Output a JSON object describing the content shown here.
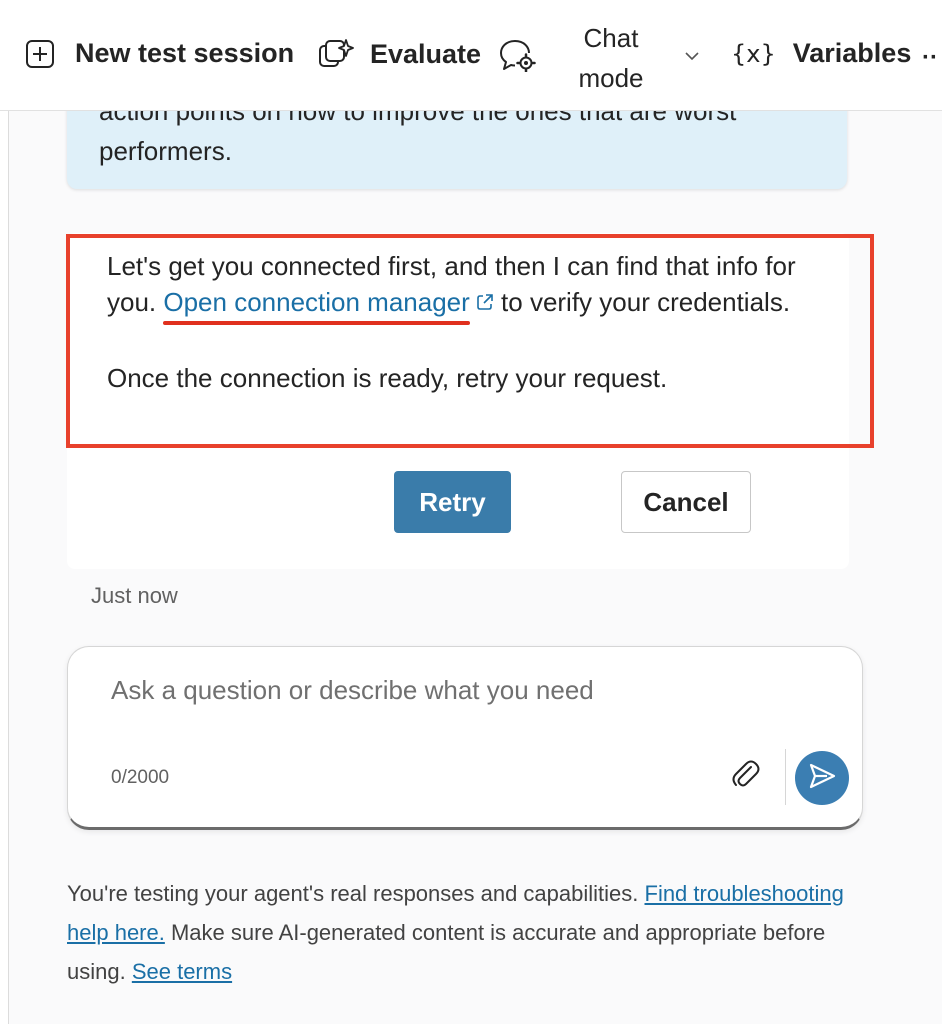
{
  "toolbar": {
    "new_session_label": "New test session",
    "evaluate_label": "Evaluate",
    "chat_mode_label": "Chat mode",
    "variables_label": "Variables",
    "variables_icon_text": "{x}",
    "more_label": "··"
  },
  "chat": {
    "user_message_line1": "action points on how to improve the ones that are worst",
    "user_message_line2": "performers.",
    "bot_text_before_link": "Let's get you connected first, and then I can find that info for you. ",
    "bot_link_text": "Open connection manager",
    "bot_text_after_link": " to verify your credentials.",
    "bot_second_paragraph": "Once the connection is ready, retry your request.",
    "retry_label": "Retry",
    "cancel_label": "Cancel",
    "timestamp": "Just now"
  },
  "input": {
    "placeholder": "Ask a question or describe what you need",
    "char_count": "0/2000"
  },
  "footer": {
    "text1": "You're testing your agent's real responses and capabilities. ",
    "link1": "Find troubleshooting help here.",
    "text2": " Make sure AI-generated content is accurate and appropriate before using. ",
    "link2": "See terms"
  },
  "icons": {
    "new_session": "plus-square-icon",
    "evaluate": "sparkle-copy-icon",
    "chat_mode": "chat-gear-icon",
    "chat_mode_dropdown": "chevron-down-icon",
    "variables": "variable-icon",
    "external_link": "open-external-icon",
    "attach": "paperclip-icon",
    "send": "send-icon"
  },
  "colors": {
    "accent": "#3a7caa",
    "link": "#1a6fa6",
    "highlight_border": "#e8412c",
    "user_bubble": "#dff0f9"
  }
}
